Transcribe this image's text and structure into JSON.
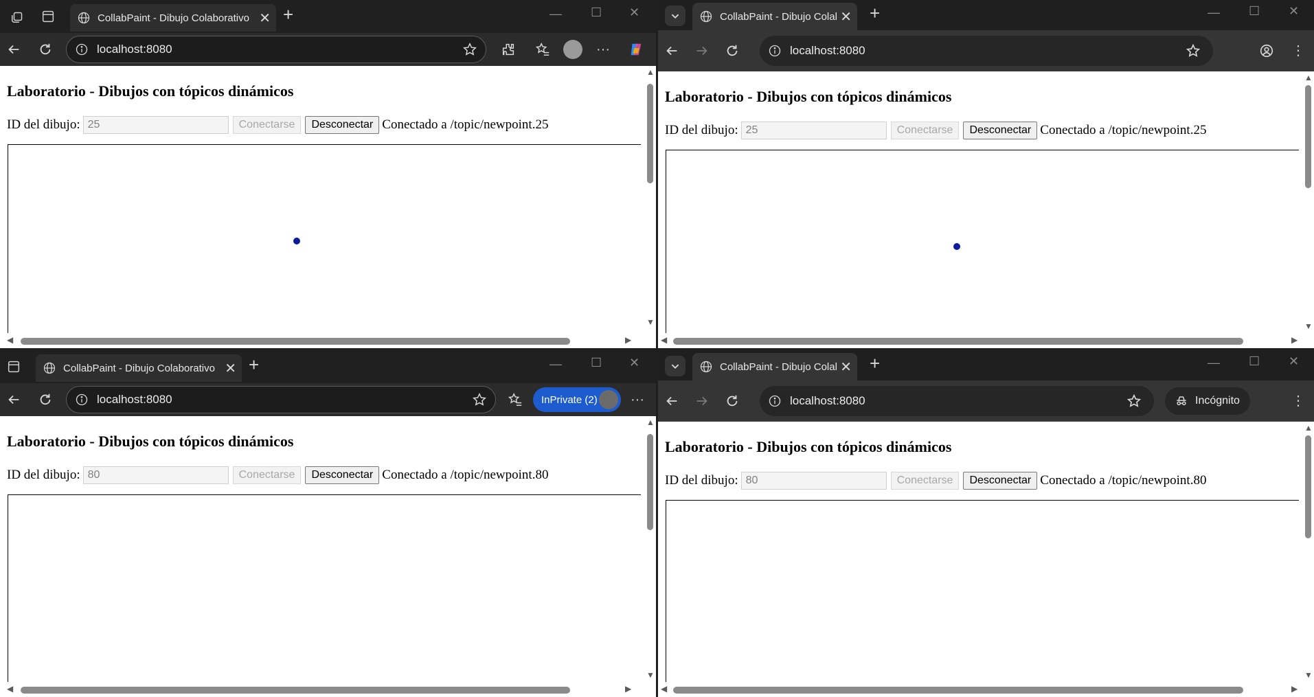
{
  "tab_title": "CollabPaint - Dibujo Colaborativo",
  "tab_title_trunc": "CollabPaint - Dibujo Colaborativ",
  "address": "localhost:8080",
  "page_heading": "Laboratorio - Dibujos con tópicos dinámicos",
  "id_label": "ID del dibujo:",
  "connect_label": "Conectarse",
  "disconnect_label": "Desconectar",
  "inprivate_label": "InPrivate (2)",
  "incognito_label": "Incógnito",
  "windows": {
    "tl": {
      "id_value": "25",
      "status": "Conectado a /topic/newpoint.25"
    },
    "tr": {
      "id_value": "25",
      "status": "Conectado a /topic/newpoint.25"
    },
    "bl": {
      "id_value": "80",
      "status": "Conectado a /topic/newpoint.80"
    },
    "br": {
      "id_value": "80",
      "status": "Conectado a /topic/newpoint.80"
    }
  },
  "colors": {
    "dot": "#0d1a9e",
    "inprivate": "#1d5ccf"
  },
  "icons": [
    "globe-icon",
    "close-icon",
    "plus-icon",
    "back-icon",
    "refresh-icon",
    "forward-icon",
    "info-icon",
    "star-icon",
    "extensions-icon",
    "favorites-icon",
    "profile-icon",
    "more-icon",
    "copilot-icon",
    "tab-actions-icon",
    "vertical-tabs-icon",
    "tab-search-icon",
    "incognito-icon",
    "minimize-icon",
    "maximize-icon",
    "window-close-icon"
  ]
}
